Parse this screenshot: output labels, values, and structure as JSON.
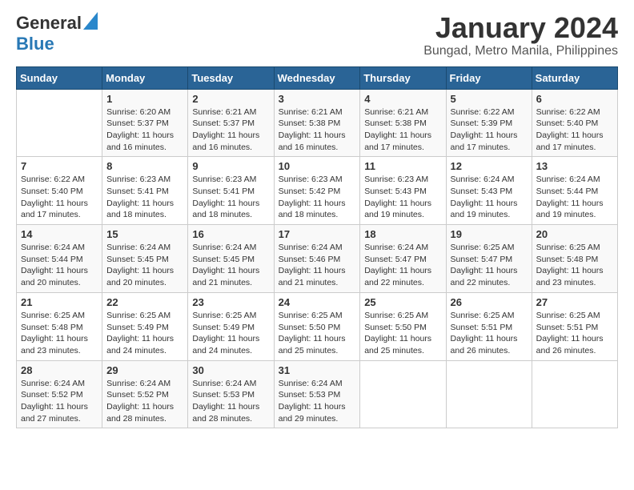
{
  "header": {
    "logo_general": "General",
    "logo_blue": "Blue",
    "title": "January 2024",
    "subtitle": "Bungad, Metro Manila, Philippines"
  },
  "calendar": {
    "days_of_week": [
      "Sunday",
      "Monday",
      "Tuesday",
      "Wednesday",
      "Thursday",
      "Friday",
      "Saturday"
    ],
    "weeks": [
      [
        {
          "day": "",
          "sunrise": "",
          "sunset": "",
          "daylight": ""
        },
        {
          "day": "1",
          "sunrise": "Sunrise: 6:20 AM",
          "sunset": "Sunset: 5:37 PM",
          "daylight": "Daylight: 11 hours and 16 minutes."
        },
        {
          "day": "2",
          "sunrise": "Sunrise: 6:21 AM",
          "sunset": "Sunset: 5:37 PM",
          "daylight": "Daylight: 11 hours and 16 minutes."
        },
        {
          "day": "3",
          "sunrise": "Sunrise: 6:21 AM",
          "sunset": "Sunset: 5:38 PM",
          "daylight": "Daylight: 11 hours and 16 minutes."
        },
        {
          "day": "4",
          "sunrise": "Sunrise: 6:21 AM",
          "sunset": "Sunset: 5:38 PM",
          "daylight": "Daylight: 11 hours and 17 minutes."
        },
        {
          "day": "5",
          "sunrise": "Sunrise: 6:22 AM",
          "sunset": "Sunset: 5:39 PM",
          "daylight": "Daylight: 11 hours and 17 minutes."
        },
        {
          "day": "6",
          "sunrise": "Sunrise: 6:22 AM",
          "sunset": "Sunset: 5:40 PM",
          "daylight": "Daylight: 11 hours and 17 minutes."
        }
      ],
      [
        {
          "day": "7",
          "sunrise": "Sunrise: 6:22 AM",
          "sunset": "Sunset: 5:40 PM",
          "daylight": "Daylight: 11 hours and 17 minutes."
        },
        {
          "day": "8",
          "sunrise": "Sunrise: 6:23 AM",
          "sunset": "Sunset: 5:41 PM",
          "daylight": "Daylight: 11 hours and 18 minutes."
        },
        {
          "day": "9",
          "sunrise": "Sunrise: 6:23 AM",
          "sunset": "Sunset: 5:41 PM",
          "daylight": "Daylight: 11 hours and 18 minutes."
        },
        {
          "day": "10",
          "sunrise": "Sunrise: 6:23 AM",
          "sunset": "Sunset: 5:42 PM",
          "daylight": "Daylight: 11 hours and 18 minutes."
        },
        {
          "day": "11",
          "sunrise": "Sunrise: 6:23 AM",
          "sunset": "Sunset: 5:43 PM",
          "daylight": "Daylight: 11 hours and 19 minutes."
        },
        {
          "day": "12",
          "sunrise": "Sunrise: 6:24 AM",
          "sunset": "Sunset: 5:43 PM",
          "daylight": "Daylight: 11 hours and 19 minutes."
        },
        {
          "day": "13",
          "sunrise": "Sunrise: 6:24 AM",
          "sunset": "Sunset: 5:44 PM",
          "daylight": "Daylight: 11 hours and 19 minutes."
        }
      ],
      [
        {
          "day": "14",
          "sunrise": "Sunrise: 6:24 AM",
          "sunset": "Sunset: 5:44 PM",
          "daylight": "Daylight: 11 hours and 20 minutes."
        },
        {
          "day": "15",
          "sunrise": "Sunrise: 6:24 AM",
          "sunset": "Sunset: 5:45 PM",
          "daylight": "Daylight: 11 hours and 20 minutes."
        },
        {
          "day": "16",
          "sunrise": "Sunrise: 6:24 AM",
          "sunset": "Sunset: 5:45 PM",
          "daylight": "Daylight: 11 hours and 21 minutes."
        },
        {
          "day": "17",
          "sunrise": "Sunrise: 6:24 AM",
          "sunset": "Sunset: 5:46 PM",
          "daylight": "Daylight: 11 hours and 21 minutes."
        },
        {
          "day": "18",
          "sunrise": "Sunrise: 6:24 AM",
          "sunset": "Sunset: 5:47 PM",
          "daylight": "Daylight: 11 hours and 22 minutes."
        },
        {
          "day": "19",
          "sunrise": "Sunrise: 6:25 AM",
          "sunset": "Sunset: 5:47 PM",
          "daylight": "Daylight: 11 hours and 22 minutes."
        },
        {
          "day": "20",
          "sunrise": "Sunrise: 6:25 AM",
          "sunset": "Sunset: 5:48 PM",
          "daylight": "Daylight: 11 hours and 23 minutes."
        }
      ],
      [
        {
          "day": "21",
          "sunrise": "Sunrise: 6:25 AM",
          "sunset": "Sunset: 5:48 PM",
          "daylight": "Daylight: 11 hours and 23 minutes."
        },
        {
          "day": "22",
          "sunrise": "Sunrise: 6:25 AM",
          "sunset": "Sunset: 5:49 PM",
          "daylight": "Daylight: 11 hours and 24 minutes."
        },
        {
          "day": "23",
          "sunrise": "Sunrise: 6:25 AM",
          "sunset": "Sunset: 5:49 PM",
          "daylight": "Daylight: 11 hours and 24 minutes."
        },
        {
          "day": "24",
          "sunrise": "Sunrise: 6:25 AM",
          "sunset": "Sunset: 5:50 PM",
          "daylight": "Daylight: 11 hours and 25 minutes."
        },
        {
          "day": "25",
          "sunrise": "Sunrise: 6:25 AM",
          "sunset": "Sunset: 5:50 PM",
          "daylight": "Daylight: 11 hours and 25 minutes."
        },
        {
          "day": "26",
          "sunrise": "Sunrise: 6:25 AM",
          "sunset": "Sunset: 5:51 PM",
          "daylight": "Daylight: 11 hours and 26 minutes."
        },
        {
          "day": "27",
          "sunrise": "Sunrise: 6:25 AM",
          "sunset": "Sunset: 5:51 PM",
          "daylight": "Daylight: 11 hours and 26 minutes."
        }
      ],
      [
        {
          "day": "28",
          "sunrise": "Sunrise: 6:24 AM",
          "sunset": "Sunset: 5:52 PM",
          "daylight": "Daylight: 11 hours and 27 minutes."
        },
        {
          "day": "29",
          "sunrise": "Sunrise: 6:24 AM",
          "sunset": "Sunset: 5:52 PM",
          "daylight": "Daylight: 11 hours and 28 minutes."
        },
        {
          "day": "30",
          "sunrise": "Sunrise: 6:24 AM",
          "sunset": "Sunset: 5:53 PM",
          "daylight": "Daylight: 11 hours and 28 minutes."
        },
        {
          "day": "31",
          "sunrise": "Sunrise: 6:24 AM",
          "sunset": "Sunset: 5:53 PM",
          "daylight": "Daylight: 11 hours and 29 minutes."
        },
        {
          "day": "",
          "sunrise": "",
          "sunset": "",
          "daylight": ""
        },
        {
          "day": "",
          "sunrise": "",
          "sunset": "",
          "daylight": ""
        },
        {
          "day": "",
          "sunrise": "",
          "sunset": "",
          "daylight": ""
        }
      ]
    ]
  }
}
